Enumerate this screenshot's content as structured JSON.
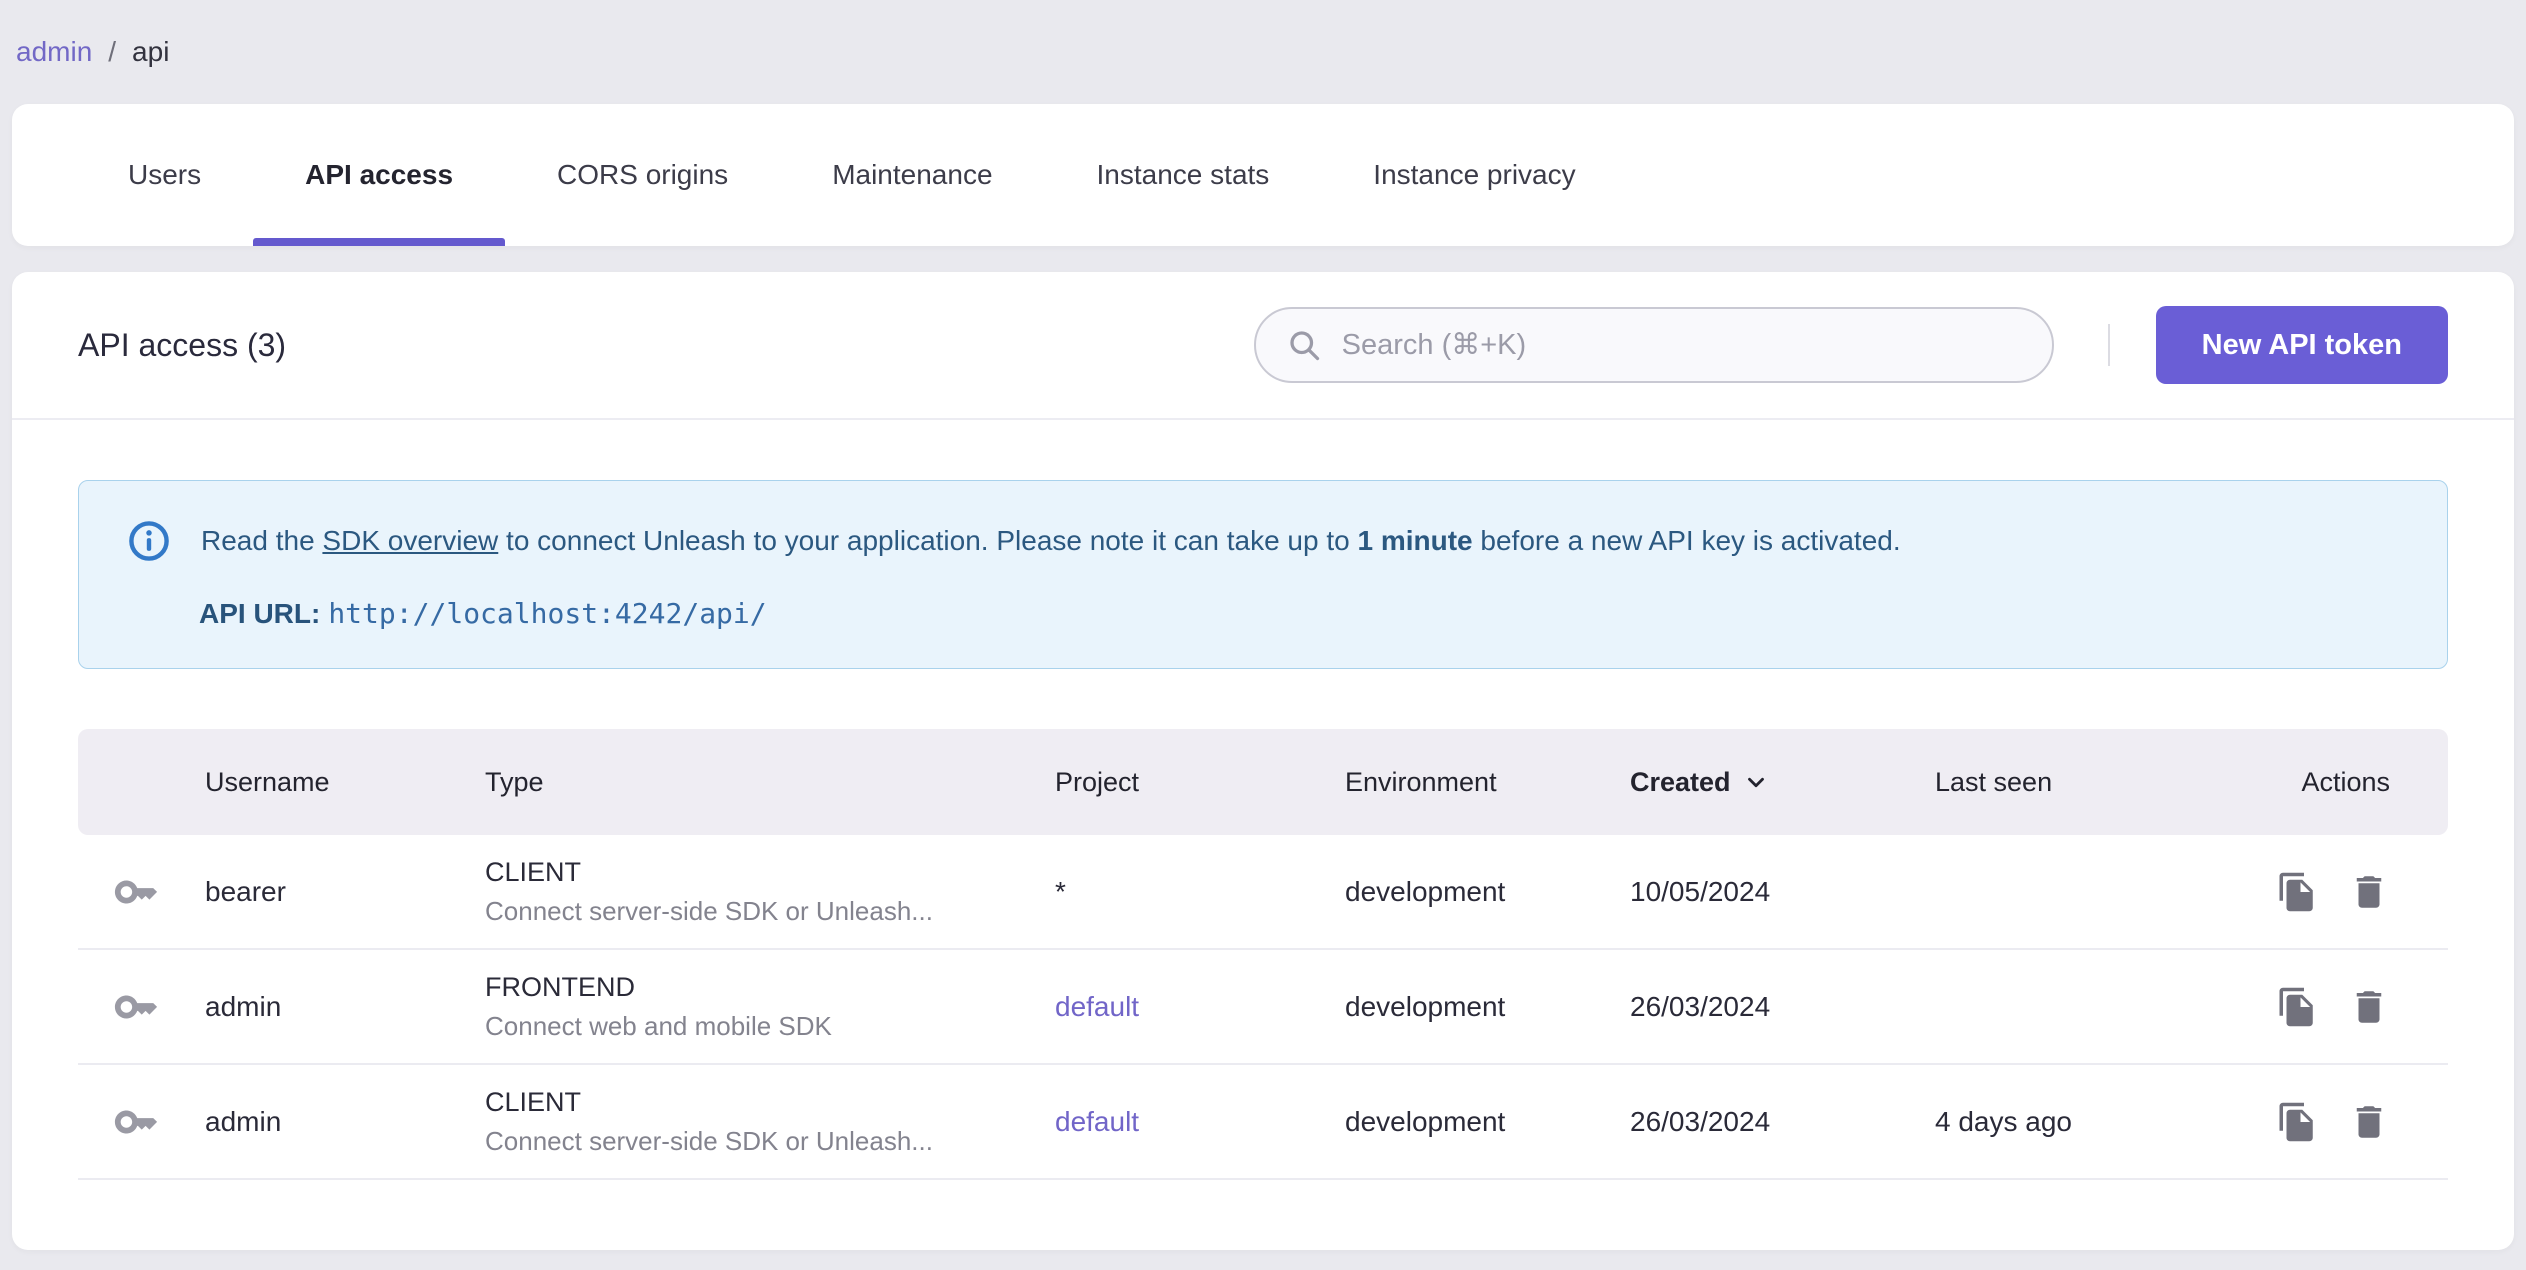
{
  "breadcrumb": {
    "items": [
      {
        "label": "admin"
      },
      {
        "label": "api"
      }
    ],
    "separator": "/"
  },
  "tabs": [
    {
      "label": "Users",
      "active": false
    },
    {
      "label": "API access",
      "active": true
    },
    {
      "label": "CORS origins",
      "active": false
    },
    {
      "label": "Maintenance",
      "active": false
    },
    {
      "label": "Instance stats",
      "active": false
    },
    {
      "label": "Instance privacy",
      "active": false
    }
  ],
  "header": {
    "title": "API access (3)",
    "search_placeholder": "Search (⌘+K)",
    "new_token_button": "New API token"
  },
  "alert": {
    "text_prefix": "Read the ",
    "link_text": "SDK overview",
    "text_middle": " to connect Unleash to your application. Please note it can take up to ",
    "bold_text": "1 minute",
    "text_suffix": " before a new API key is activated.",
    "api_url_label": "API URL",
    "api_url_separator": ":",
    "api_url": "http://localhost:4242/api/"
  },
  "table": {
    "columns": [
      "Username",
      "Type",
      "Project",
      "Environment",
      "Created",
      "Last seen",
      "Actions"
    ],
    "sorted_column": "Created",
    "sort_direction": "desc",
    "rows": [
      {
        "username": "bearer",
        "type": "CLIENT",
        "type_description": "Connect server-side SDK or Unleash...",
        "project": "*",
        "environment": "development",
        "created": "10/05/2024",
        "last_seen": ""
      },
      {
        "username": "admin",
        "type": "FRONTEND",
        "type_description": "Connect web and mobile SDK",
        "project": "default",
        "environment": "development",
        "created": "26/03/2024",
        "last_seen": ""
      },
      {
        "username": "admin",
        "type": "CLIENT",
        "type_description": "Connect server-side SDK or Unleash...",
        "project": "default",
        "environment": "development",
        "created": "26/03/2024",
        "last_seen": "4 days ago"
      }
    ]
  },
  "icons": {
    "search": "magnifier",
    "info": "info-circle",
    "sort": "chevron-down",
    "token": "key",
    "copy": "file-copy",
    "delete": "trash",
    "command_symbol": "⌘"
  },
  "colors": {
    "page_background": "#e9e9ee",
    "card_background": "#ffffff",
    "primary_purple": "#6a5ed6",
    "tab_indicator": "#6459ce",
    "link_purple": "#7268c6",
    "alert_background": "#e9f4fc",
    "alert_border": "#a9d2ec",
    "alert_text": "#2b5880",
    "info_icon_blue": "#3279c8",
    "table_header_background": "#efedf3",
    "muted_text": "#83838e",
    "icon_gray": "#71717c",
    "key_icon_gray": "#9a9aa4"
  }
}
